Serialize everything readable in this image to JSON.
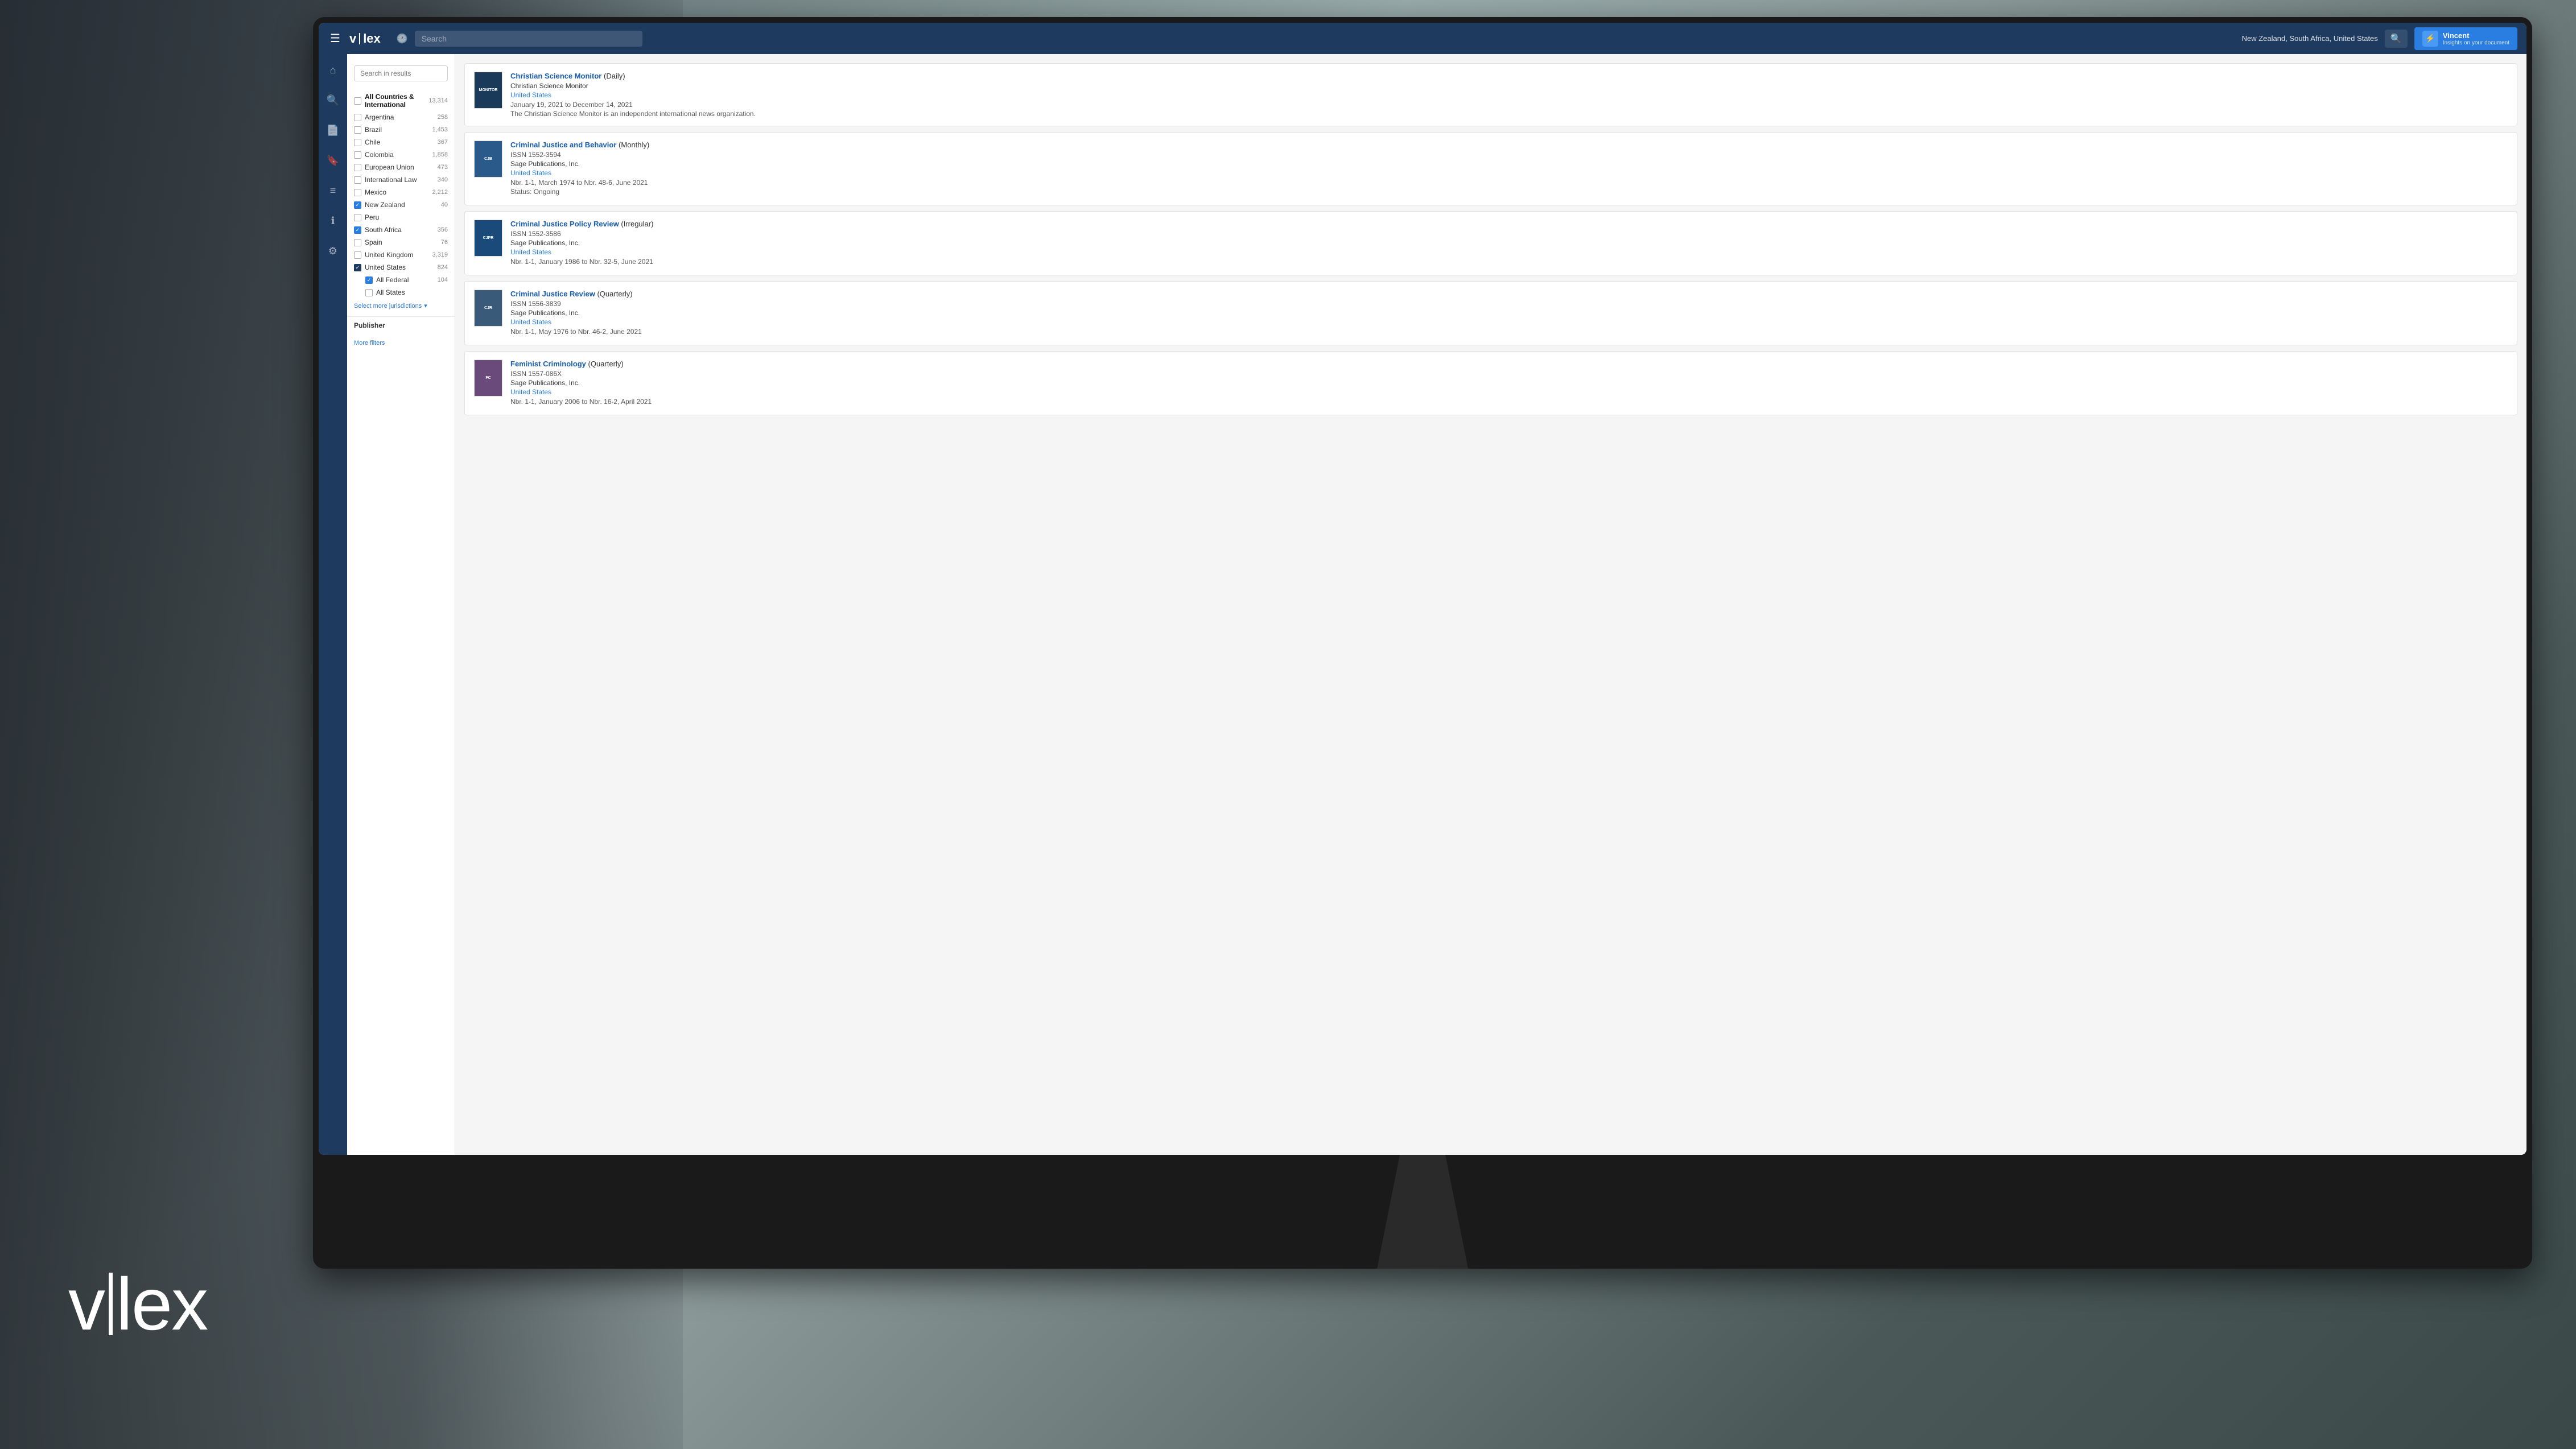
{
  "background": {
    "color": "#6a7a88"
  },
  "vlex_logo_bg": "v|lex",
  "navbar": {
    "logo": "v|lex",
    "search_placeholder": "Search",
    "jurisdiction_label": "New Zealand, South Africa, United States",
    "vincent_name": "Vincent",
    "vincent_subtitle": "Insights on your document",
    "vincent_icon": "V"
  },
  "filters": {
    "search_placeholder": "Search in results",
    "items": [
      {
        "label": "All Countries & International",
        "count": "13,314",
        "checked": false,
        "bold": true
      },
      {
        "label": "Argentina",
        "count": "258",
        "checked": false
      },
      {
        "label": "Brazil",
        "count": "1,453",
        "checked": false
      },
      {
        "label": "Chile",
        "count": "367",
        "checked": false
      },
      {
        "label": "Colombia",
        "count": "1,858",
        "checked": false
      },
      {
        "label": "European Union",
        "count": "473",
        "checked": false
      },
      {
        "label": "International Law",
        "count": "340",
        "checked": false
      },
      {
        "label": "Mexico",
        "count": "2,212",
        "checked": false
      },
      {
        "label": "New Zealand",
        "count": "40",
        "checked": true
      },
      {
        "label": "Peru",
        "count": "",
        "checked": false
      },
      {
        "label": "South Africa",
        "count": "356",
        "checked": true
      },
      {
        "label": "Spain",
        "count": "76",
        "checked": false
      },
      {
        "label": "United Kingdom",
        "count": "3,319",
        "checked": false
      },
      {
        "label": "United States",
        "count": "824",
        "checked": true,
        "expanded": true
      }
    ],
    "us_sub": [
      {
        "label": "All Federal",
        "count": "104",
        "checked": true
      },
      {
        "label": "All States",
        "count": "",
        "checked": false
      }
    ],
    "select_more": "Select more jurisdictions",
    "publisher_title": "Publisher",
    "more_filters": "More filters"
  },
  "results": [
    {
      "id": 1,
      "title": "Christian Science Monitor",
      "frequency": "Daily",
      "publisher": "Christian Science Monitor",
      "country": "United States",
      "date_range": "January 19, 2021 to December 14, 2021",
      "description": "The Christian Science Monitor is an independent international news organization.",
      "thumbnail_type": "monitor"
    },
    {
      "id": 2,
      "title": "Criminal Justice and Behavior",
      "frequency": "Monthly",
      "issn": "ISSN 1552-3594",
      "publisher": "Sage Publications, Inc.",
      "country": "United States",
      "nbr": "Nbr. 1-1, March 1974 to Nbr. 48-6, June 2021",
      "status": "Status: Ongoing",
      "thumbnail_type": "journal"
    },
    {
      "id": 3,
      "title": "Criminal Justice Policy Review",
      "frequency": "Irregular",
      "issn": "ISSN 1552-3586",
      "publisher": "Sage Publications, Inc.",
      "country": "United States",
      "nbr": "Nbr. 1-1, January 1986 to Nbr. 32-5, June 2021",
      "thumbnail_type": "journal"
    },
    {
      "id": 4,
      "title": "Criminal Justice Review",
      "frequency": "Quarterly",
      "issn": "ISSN 1556-3839",
      "publisher": "Sage Publications, Inc.",
      "country": "United States",
      "nbr": "Nbr. 1-1, May 1976 to Nbr. 46-2, June 2021",
      "thumbnail_type": "journal"
    },
    {
      "id": 5,
      "title": "Feminist Criminology",
      "frequency": "Quarterly",
      "issn": "ISSN 1557-086X",
      "publisher": "Sage Publications, Inc.",
      "country": "United States",
      "nbr": "Nbr. 1-1, January 2006 to Nbr. 16-2, April 2021",
      "thumbnail_type": "journal"
    }
  ],
  "sidebar_icons": [
    "home",
    "search",
    "document",
    "bookmark",
    "menu",
    "info",
    "settings"
  ]
}
